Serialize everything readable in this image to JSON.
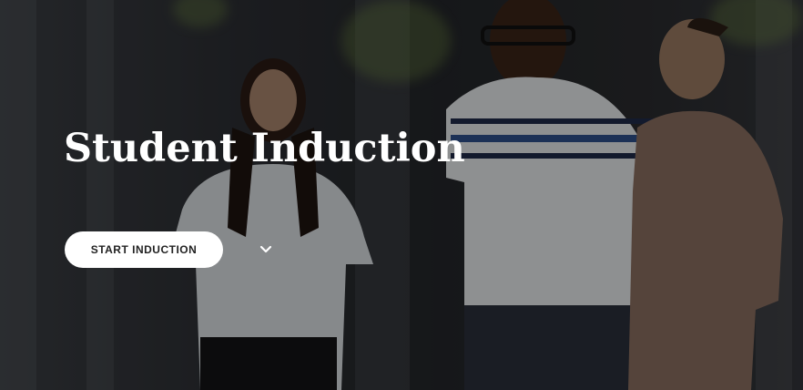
{
  "hero": {
    "title": "Student Induction",
    "cta_label": "START INDUCTION",
    "scroll_icon": "chevron-down-icon",
    "background_image": "photo of three students walking outdoors"
  },
  "colors": {
    "title": "#ffffff",
    "button_bg": "#ffffff",
    "button_text": "#222222",
    "overlay": "rgba(0,0,0,0.38)"
  }
}
